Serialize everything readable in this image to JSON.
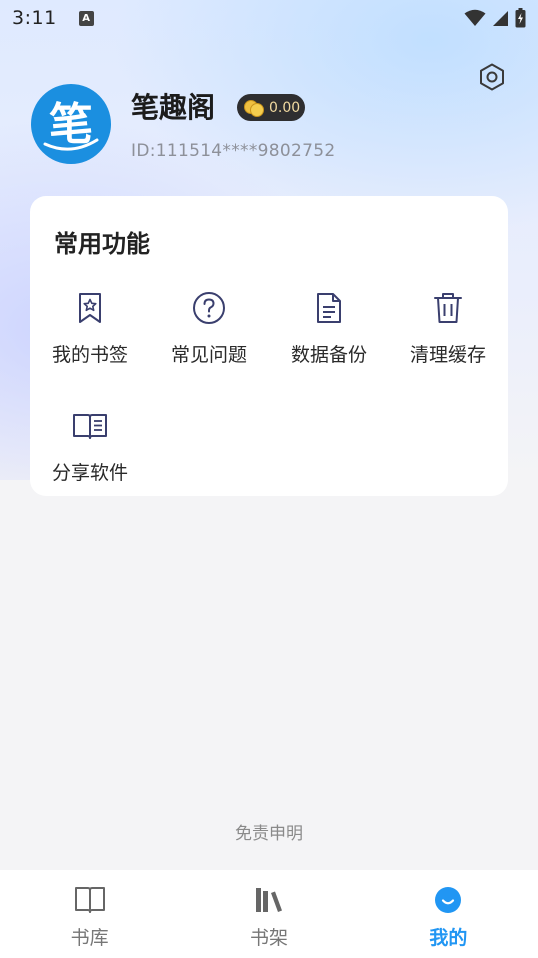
{
  "status_bar": {
    "time": "3:11",
    "notification_glyph": "A"
  },
  "profile": {
    "avatar_glyph": "笔",
    "name": "笔趣阁",
    "coins": "0.00",
    "user_id": "ID:111514****9802752"
  },
  "functions": {
    "title": "常用功能",
    "items": [
      {
        "label": "我的书签",
        "icon": "bookmark-icon"
      },
      {
        "label": "常见问题",
        "icon": "question-icon"
      },
      {
        "label": "数据备份",
        "icon": "document-icon"
      },
      {
        "label": "清理缓存",
        "icon": "trash-icon"
      },
      {
        "label": "分享软件",
        "icon": "book-open-icon"
      }
    ]
  },
  "disclaimer": "免责申明",
  "tabbar": {
    "tabs": [
      {
        "label": "书库",
        "icon": "book-icon",
        "active": false
      },
      {
        "label": "书架",
        "icon": "shelf-icon",
        "active": false
      },
      {
        "label": "我的",
        "icon": "smile-icon",
        "active": true
      }
    ]
  },
  "colors": {
    "accent": "#2196f3",
    "icon_stroke": "#3a3f6e",
    "avatar_bg": "#1b8fe0",
    "badge_bg": "#2e2e30",
    "coin_gold": "#f0c040"
  }
}
